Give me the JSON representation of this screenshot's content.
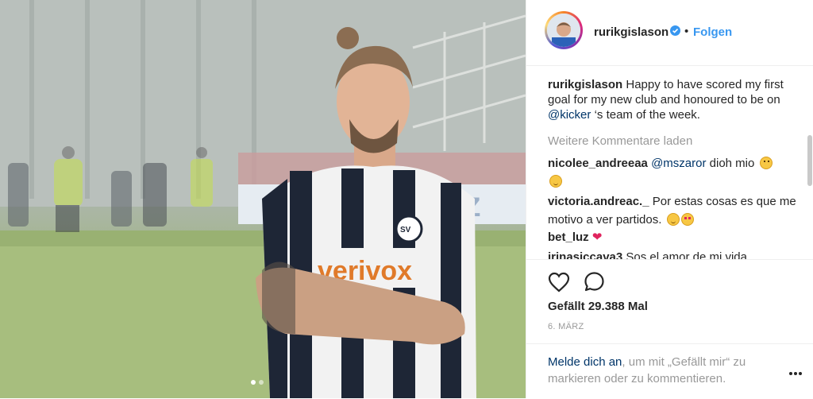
{
  "post": {
    "photo_alt": "Player in black and white striped jersey",
    "carousel": {
      "count": 2,
      "active": 1
    }
  },
  "header": {
    "username": "rurikgislason",
    "verified_icon": "verified-badge-icon",
    "separator": "•",
    "follow_label": "Folgen"
  },
  "caption": {
    "username": "rurikgislason",
    "text_before": "Happy to have scored my first goal for my new club and honoured to be on ",
    "mention": "@kicker",
    "text_after": " ‘s team of the week."
  },
  "load_more": "Weitere Kommentare laden",
  "comments": [
    {
      "username": "nicolee_andreeaa",
      "mention": "@mszaror",
      "text": " dioh mio ",
      "emoji": "flushed-face-icon"
    },
    {
      "username": "victoria.andreac._",
      "text": " Por estas cosas es que me motivo a ver partidos. ",
      "emoji": [
        "smiling-face-icon",
        "heart-eyes-face-icon"
      ]
    },
    {
      "username": "bet_luz",
      "emoji": "red-heart-icon",
      "heart_glyph": "❤"
    },
    {
      "username": "irinasiccava3",
      "text": " Sos el amor de mi vida"
    }
  ],
  "actions": {
    "like_icon": "heart-outline-icon",
    "comment_icon": "comment-bubble-icon"
  },
  "likes_text": "Gefällt 29.388 Mal",
  "date": "6. MÄRZ",
  "login": {
    "link": "Melde dich an",
    "rest": ", um mit „Gefällt mir“ zu markieren oder zu kommentieren."
  },
  "colors": {
    "accent": "#3897f0",
    "link": "#003569",
    "muted": "#999999",
    "heart": "#e0245e"
  }
}
